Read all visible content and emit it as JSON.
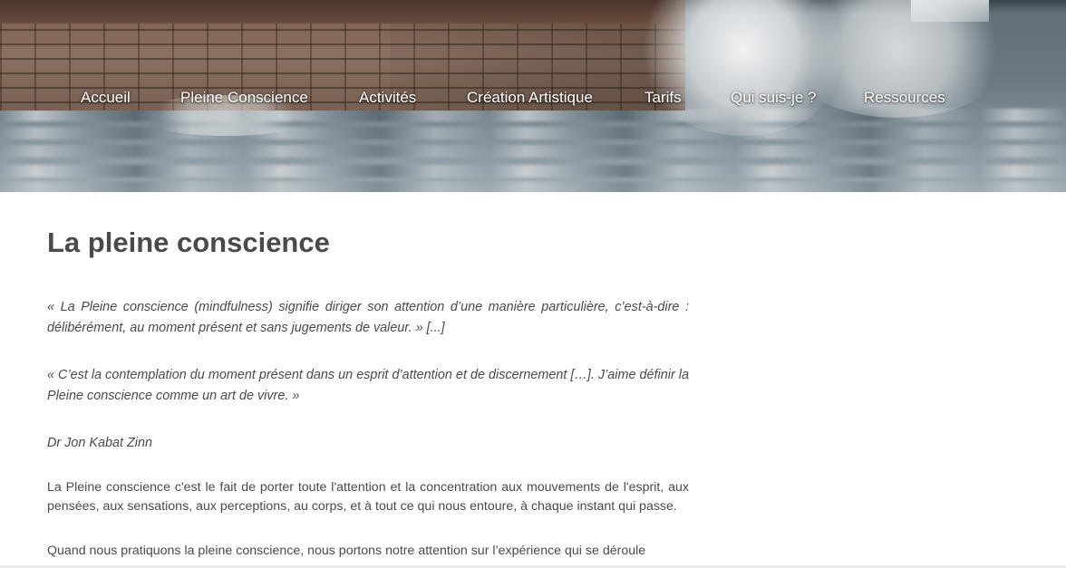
{
  "nav": {
    "items": [
      {
        "label": "Accueil"
      },
      {
        "label": "Pleine Conscience"
      },
      {
        "label": "Activités"
      },
      {
        "label": "Création Artistique"
      },
      {
        "label": "Tarifs"
      },
      {
        "label": "Qui suis-je ?"
      },
      {
        "label": "Ressources"
      }
    ]
  },
  "main": {
    "title": "La pleine conscience",
    "paragraphs": [
      "« La Pleine conscience (mindfulness) signifie diriger son attention d’une manière particulière, c’est-à-dire : délibérément, au moment présent et sans jugements de valeur. » [...]",
      "« C’est la contemplation du moment présent dans un esprit d’attention et de discernement […]. J’aime définir la Pleine conscience comme un art de vivre. »",
      "Dr Jon Kabat Zinn",
      "La Pleine conscience c'est le fait de porter toute l'attention et la concentration aux mouvements de l'esprit, aux pensées, aux sensations, aux perceptions, au corps, et à tout ce qui nous entoure, à chaque instant qui passe.",
      "Quand nous pratiquons la pleine conscience, nous portons notre attention sur l’expérience qui se déroule"
    ]
  },
  "colors": {
    "text": "#4a4a4a",
    "nav_text": "#ffffff",
    "background": "#ffffff"
  }
}
